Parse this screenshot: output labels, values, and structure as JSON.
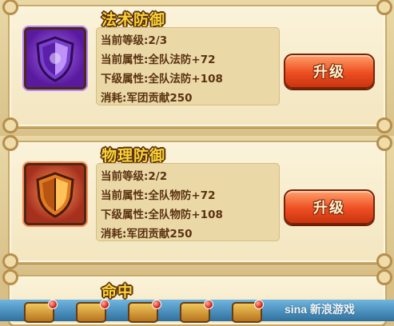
{
  "skills": [
    {
      "title": "法术防御",
      "icon": "purple-shield-icon",
      "level": "当前等级:2/3",
      "current_attr": "当前属性:全队法防+72",
      "next_attr": "下级属性:全队法防+108",
      "cost": "消耗:军团贡献250",
      "button": "升级"
    },
    {
      "title": "物理防御",
      "icon": "orange-shield-icon",
      "level": "当前等级:2/2",
      "current_attr": "当前属性:全队物防+72",
      "next_attr": "下级属性:全队物防+108",
      "cost": "消耗:军团贡献250",
      "button": "升级"
    },
    {
      "title": "命中"
    }
  ],
  "watermark": "sina 新浪游戏",
  "colors": {
    "title": "#f8d437",
    "button": "#ee4e22",
    "card": "#fbf3da",
    "stat_text": "#5b3210"
  }
}
